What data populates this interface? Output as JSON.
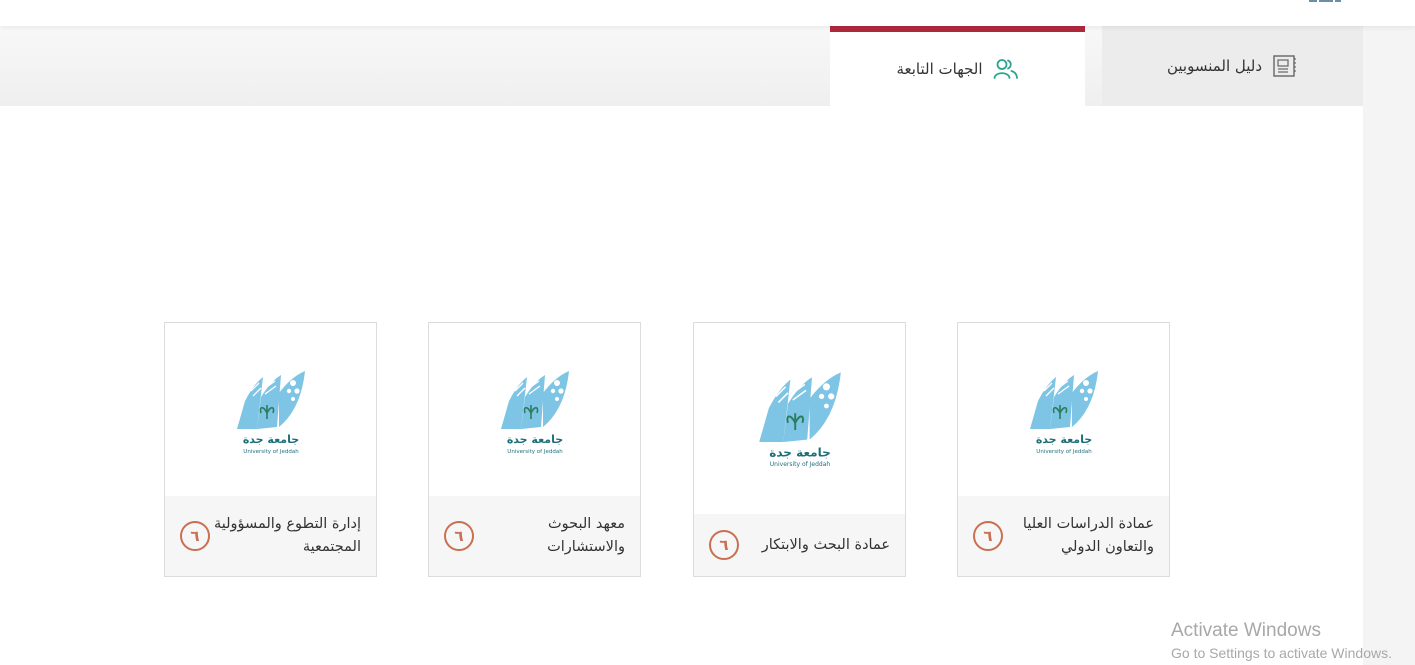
{
  "tabs": {
    "members_label": "دليل المنسوبين",
    "affiliates_label": "الجهات التابعة"
  },
  "logo": {
    "arabic_name": "جامعة جدة",
    "english_name": "University of Jeddah"
  },
  "cards": [
    {
      "title": "عمادة الدراسات العليا والتعاون الدولي",
      "badge": "٦"
    },
    {
      "title": "عمادة البحث والابتكار",
      "badge": "٦"
    },
    {
      "title": "معهد البحوث والاستشارات",
      "badge": "٦"
    },
    {
      "title": "إدارة التطوع والمسؤولية المجتمعية",
      "badge": "٦"
    }
  ],
  "watermark": {
    "title": "Activate Windows",
    "subtitle": "Go to Settings to activate Windows."
  },
  "colors": {
    "accent": "#b0283d",
    "badge": "#c97052",
    "icon_teal": "#2ba58f",
    "logo_blue": "#7ec4e4",
    "logo_text": "#1e6f7c"
  }
}
